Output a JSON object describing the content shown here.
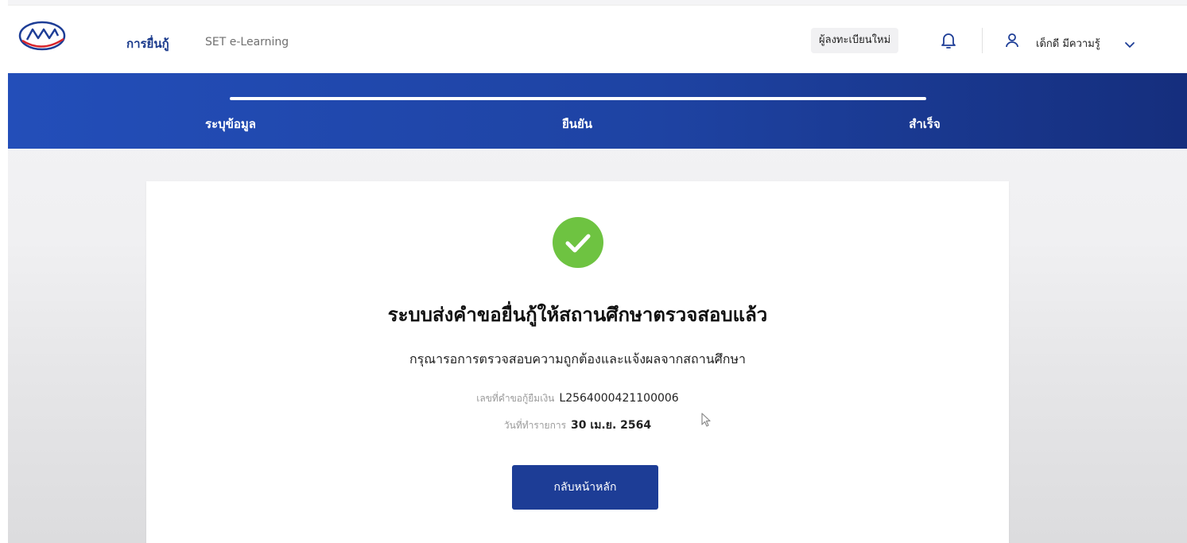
{
  "header": {
    "logo_icon": "kor-yor-sor-logo",
    "nav": {
      "loan_label": "การยื่นกู้",
      "elearning_label": "SET e-Learning"
    },
    "register_label": "ผู้ลงทะเบียนใหม่",
    "bell_icon": "bell-icon",
    "user": {
      "icon": "user-icon",
      "name": "เด็กดี มีความรู้",
      "chevron_icon": "chevron-down-icon"
    }
  },
  "stepper": {
    "steps": [
      {
        "label": "ระบุข้อมูล"
      },
      {
        "label": "ยืนยัน"
      },
      {
        "label": "สำเร็จ"
      }
    ],
    "current_step": 3,
    "colors": {
      "banner_start": "#234eb9",
      "banner_end": "#152e7d"
    }
  },
  "result": {
    "status_icon": "check-circle-icon",
    "status_color": "#6ec341",
    "title": "ระบบส่งคำขอยื่นกู้ให้สถานศึกษาตรวจสอบแล้ว",
    "subtitle": "กรุณารอการตรวจสอบความถูกต้องและแจ้งผลจากสถานศึกษา",
    "request_no_label": "เลขที่คำขอกู้ยืมเงิน",
    "request_no": "L2564000421100006",
    "date_label": "วันที่ทำรายการ",
    "date": "30 เม.ย. 2564",
    "home_button_label": "กลับหน้าหลัก",
    "button_color": "#1d3d96"
  },
  "cursor_icon": "mouse-pointer-icon"
}
